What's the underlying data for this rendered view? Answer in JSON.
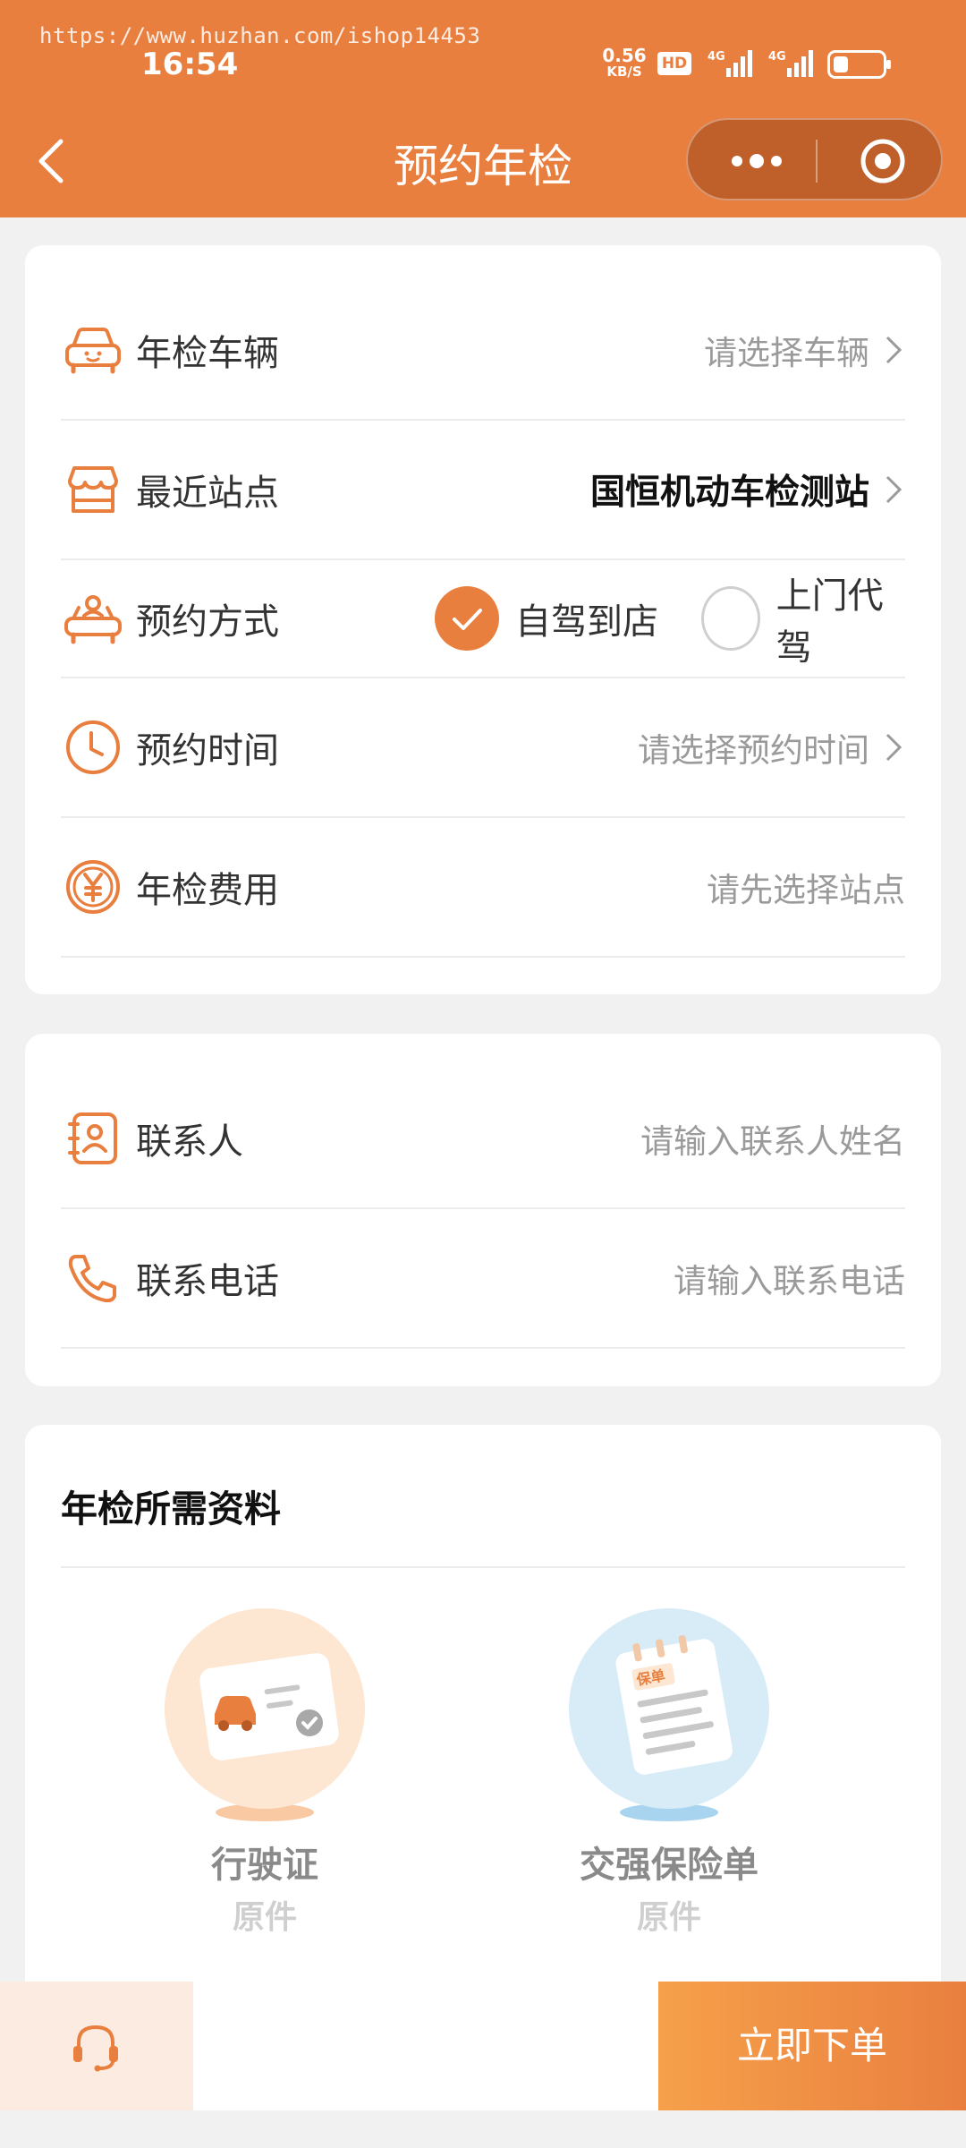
{
  "status_bar": {
    "watermark": "https://www.huzhan.com/ishop14453",
    "time": "16:54",
    "speed_value": "0.56",
    "speed_unit": "KB/S",
    "hd_badge": "HD",
    "network_1": "4G",
    "network_2": "4G",
    "battery_level": 0.3
  },
  "nav": {
    "title": "预约年检"
  },
  "form": {
    "vehicle": {
      "label": "年检车辆",
      "value": "请选择车辆"
    },
    "station": {
      "label": "最近站点",
      "value": "国恒机动车检测站"
    },
    "method": {
      "label": "预约方式",
      "options": [
        {
          "text": "自驾到店",
          "selected": true
        },
        {
          "text": "上门代驾",
          "selected": false
        }
      ]
    },
    "time": {
      "label": "预约时间",
      "value": "请选择预约时间"
    },
    "fee": {
      "label": "年检费用",
      "value": "请先选择站点"
    }
  },
  "contact": {
    "name": {
      "label": "联系人",
      "placeholder": "请输入联系人姓名"
    },
    "phone": {
      "label": "联系电话",
      "placeholder": "请输入联系电话"
    }
  },
  "materials": {
    "title": "年检所需资料",
    "items": [
      {
        "name": "行驶证",
        "sub": "原件",
        "icon": "driving-license-icon"
      },
      {
        "name": "交强保险单",
        "sub": "原件",
        "badge": "保单",
        "icon": "insurance-policy-icon"
      }
    ]
  },
  "bottom_bar": {
    "service_icon": "headset-icon",
    "order_button": "立即下单"
  },
  "colors": {
    "primary": "#e97f3f",
    "gradient_start": "#f6a04a"
  }
}
